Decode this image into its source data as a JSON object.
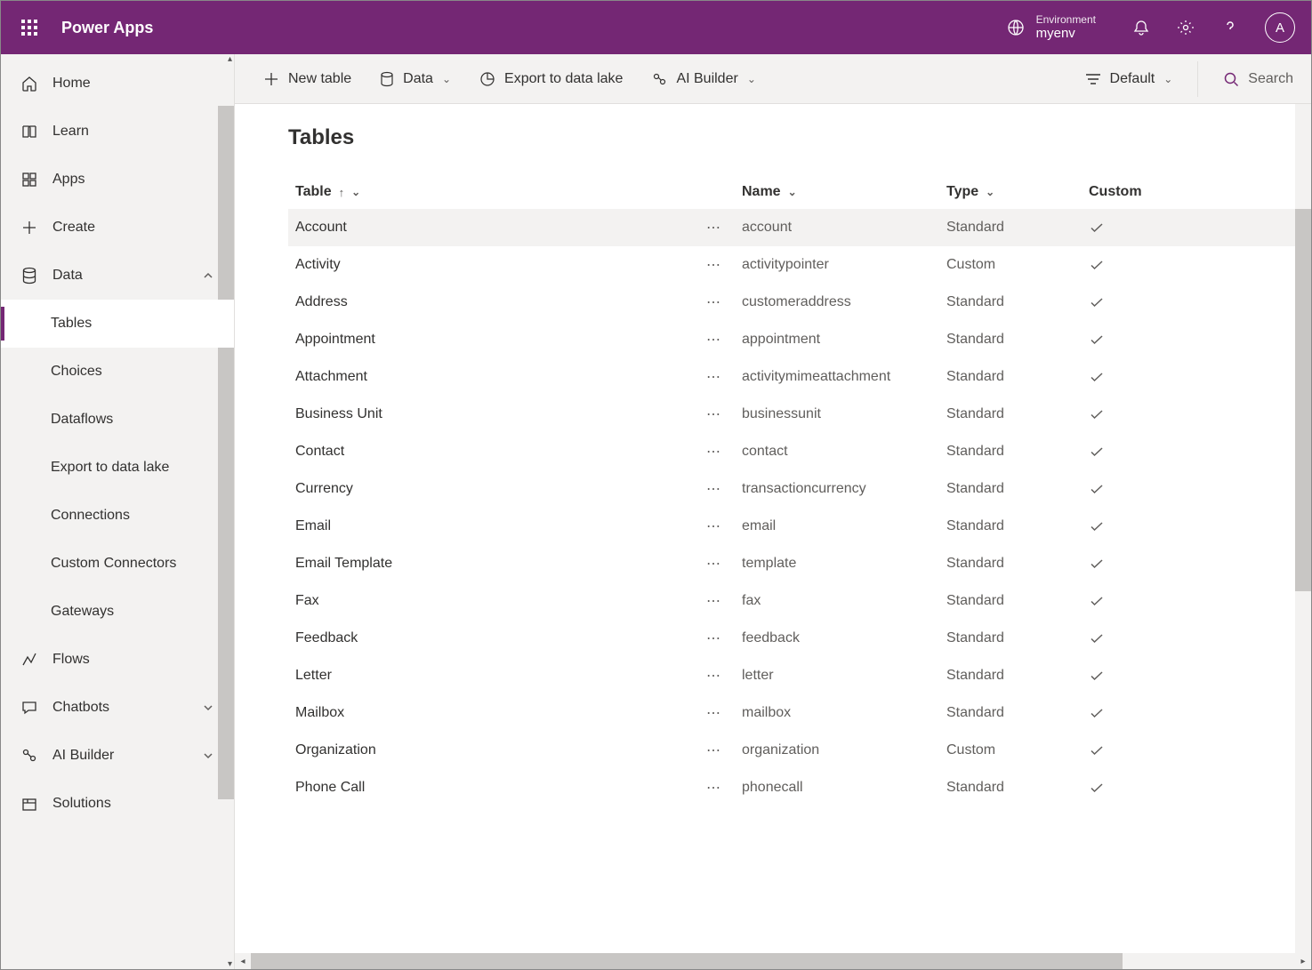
{
  "header": {
    "brand": "Power Apps",
    "env_label": "Environment",
    "env_name": "myenv",
    "avatar_initial": "A"
  },
  "sidebar": {
    "items": [
      {
        "label": "Home",
        "icon": "home"
      },
      {
        "label": "Learn",
        "icon": "book"
      },
      {
        "label": "Apps",
        "icon": "grid"
      },
      {
        "label": "Create",
        "icon": "plus"
      },
      {
        "label": "Data",
        "icon": "db",
        "expanded": true
      },
      {
        "label": "Tables",
        "sub": true,
        "active": true
      },
      {
        "label": "Choices",
        "sub": true
      },
      {
        "label": "Dataflows",
        "sub": true
      },
      {
        "label": "Export to data lake",
        "sub": true
      },
      {
        "label": "Connections",
        "sub": true
      },
      {
        "label": "Custom Connectors",
        "sub": true
      },
      {
        "label": "Gateways",
        "sub": true
      },
      {
        "label": "Flows",
        "icon": "flow"
      },
      {
        "label": "Chatbots",
        "icon": "chat",
        "chevron": true
      },
      {
        "label": "AI Builder",
        "icon": "ai",
        "chevron": true
      },
      {
        "label": "Solutions",
        "icon": "package"
      }
    ]
  },
  "cmdbar": {
    "new_table": "New table",
    "data": "Data",
    "export": "Export to data lake",
    "ai_builder": "AI Builder",
    "default": "Default",
    "search_placeholder": "Search"
  },
  "page": {
    "title": "Tables",
    "columns": {
      "table": "Table",
      "name": "Name",
      "type": "Type",
      "custom": "Custom"
    },
    "rows": [
      {
        "table": "Account",
        "name": "account",
        "type": "Standard",
        "hover": true
      },
      {
        "table": "Activity",
        "name": "activitypointer",
        "type": "Custom"
      },
      {
        "table": "Address",
        "name": "customeraddress",
        "type": "Standard"
      },
      {
        "table": "Appointment",
        "name": "appointment",
        "type": "Standard"
      },
      {
        "table": "Attachment",
        "name": "activitymimeattachment",
        "type": "Standard"
      },
      {
        "table": "Business Unit",
        "name": "businessunit",
        "type": "Standard"
      },
      {
        "table": "Contact",
        "name": "contact",
        "type": "Standard"
      },
      {
        "table": "Currency",
        "name": "transactioncurrency",
        "type": "Standard"
      },
      {
        "table": "Email",
        "name": "email",
        "type": "Standard"
      },
      {
        "table": "Email Template",
        "name": "template",
        "type": "Standard"
      },
      {
        "table": "Fax",
        "name": "fax",
        "type": "Standard"
      },
      {
        "table": "Feedback",
        "name": "feedback",
        "type": "Standard"
      },
      {
        "table": "Letter",
        "name": "letter",
        "type": "Standard"
      },
      {
        "table": "Mailbox",
        "name": "mailbox",
        "type": "Standard"
      },
      {
        "table": "Organization",
        "name": "organization",
        "type": "Custom"
      },
      {
        "table": "Phone Call",
        "name": "phonecall",
        "type": "Standard"
      }
    ]
  }
}
